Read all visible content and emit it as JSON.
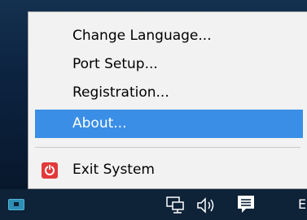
{
  "menu": {
    "items": [
      {
        "label": "Change Language..."
      },
      {
        "label": "Port Setup..."
      },
      {
        "label": "Registration..."
      },
      {
        "label": "About..."
      }
    ],
    "exit": {
      "label": "Exit System",
      "icon": "power-icon"
    },
    "highlight_color": "#3a8ee6"
  },
  "taskbar": {
    "tray_icons": [
      "app-tray-icon",
      "network-icon",
      "volume-icon",
      "action-center-icon"
    ],
    "language": "EN"
  }
}
